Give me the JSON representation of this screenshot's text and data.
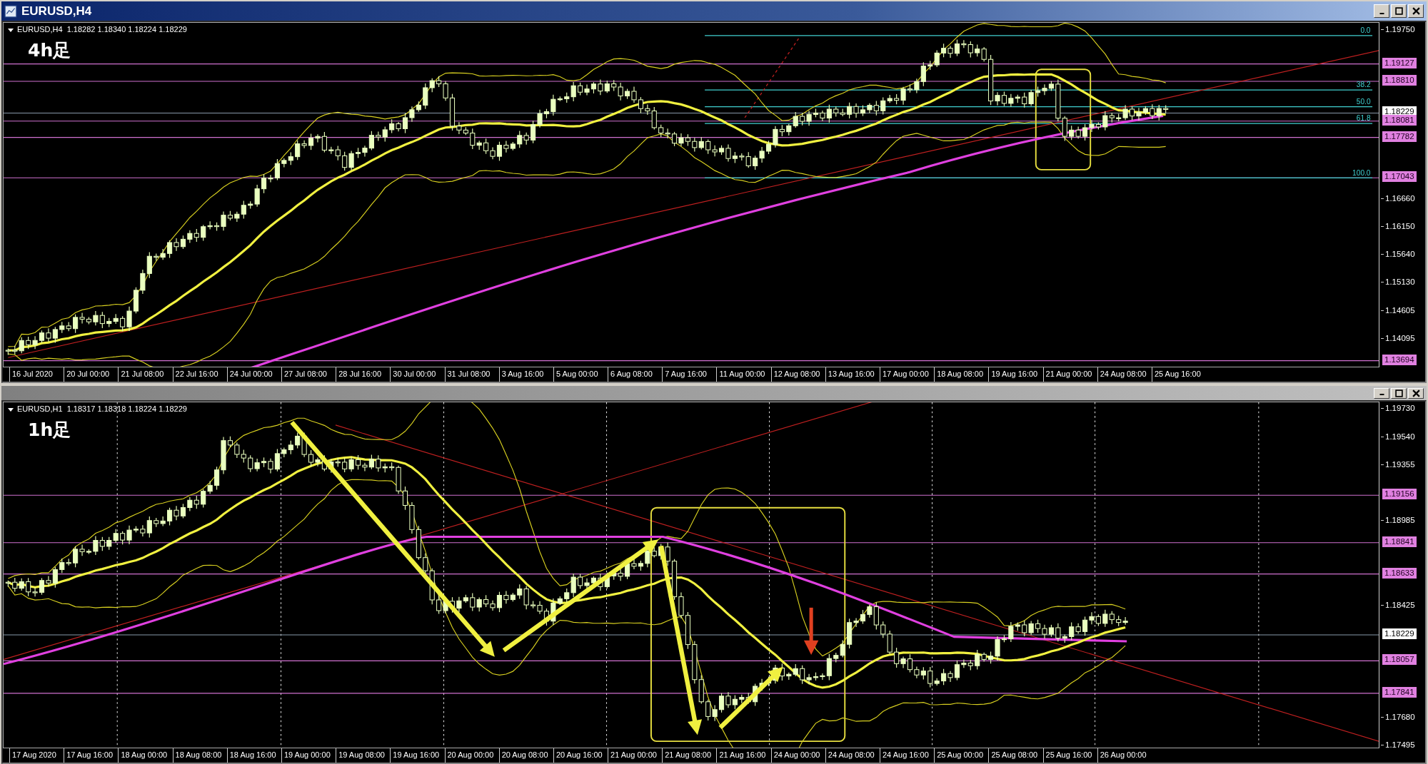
{
  "windows": [
    {
      "title": "EURUSD,H4",
      "header": "EURUSD,H4  1.18282 1.18340 1.18224 1.18229",
      "label": "4h足",
      "kind": "top",
      "price_ticks": [
        "1.19750",
        "1.16660",
        "1.16150",
        "1.15640",
        "1.15130",
        "1.14605",
        "1.14095"
      ],
      "price_badges": [
        {
          "text": "1.19127",
          "kind": "level"
        },
        {
          "text": "1.18810",
          "kind": "level"
        },
        {
          "text": "1.18229",
          "kind": "current"
        },
        {
          "text": "1.18081",
          "kind": "level"
        },
        {
          "text": "1.17782",
          "kind": "level"
        },
        {
          "text": "1.17043",
          "kind": "level"
        },
        {
          "text": "1.13694",
          "kind": "level"
        }
      ],
      "fib_labels": [
        "0.0",
        "38.2",
        "50.0",
        "61.8",
        "100.0"
      ],
      "time_labels": [
        "16 Jul 2020",
        "20 Jul 00:00",
        "21 Jul 08:00",
        "22 Jul 16:00",
        "24 Jul 00:00",
        "27 Jul 08:00",
        "28 Jul 16:00",
        "30 Jul 00:00",
        "31 Jul 08:00",
        "3 Aug 16:00",
        "5 Aug 00:00",
        "6 Aug 08:00",
        "7 Aug 16:00",
        "11 Aug 00:00",
        "12 Aug 08:00",
        "13 Aug 16:00",
        "17 Aug 00:00",
        "18 Aug 08:00",
        "19 Aug 16:00",
        "21 Aug 00:00",
        "24 Aug 08:00",
        "25 Aug 16:00"
      ]
    },
    {
      "header": "EURUSD,H1  1.18317 1.18318 1.18224 1.18229",
      "label": "1h足",
      "kind": "bottom",
      "price_ticks": [
        "1.19730",
        "1.19540",
        "1.19355",
        "1.18985",
        "1.18425",
        "1.17680",
        "1.17495"
      ],
      "price_badges": [
        {
          "text": "1.19156",
          "kind": "level"
        },
        {
          "text": "1.18841",
          "kind": "level"
        },
        {
          "text": "1.18633",
          "kind": "level"
        },
        {
          "text": "1.18229",
          "kind": "current"
        },
        {
          "text": "1.18057",
          "kind": "level"
        },
        {
          "text": "1.17841",
          "kind": "level"
        }
      ],
      "time_labels": [
        "17 Aug 2020",
        "17 Aug 16:00",
        "18 Aug 00:00",
        "18 Aug 08:00",
        "18 Aug 16:00",
        "19 Aug 00:00",
        "19 Aug 08:00",
        "19 Aug 16:00",
        "20 Aug 00:00",
        "20 Aug 08:00",
        "20 Aug 16:00",
        "21 Aug 00:00",
        "21 Aug 08:00",
        "21 Aug 16:00",
        "24 Aug 00:00",
        "24 Aug 08:00",
        "24 Aug 16:00",
        "25 Aug 00:00",
        "25 Aug 08:00",
        "25 Aug 16:00",
        "26 Aug 00:00"
      ]
    }
  ]
}
